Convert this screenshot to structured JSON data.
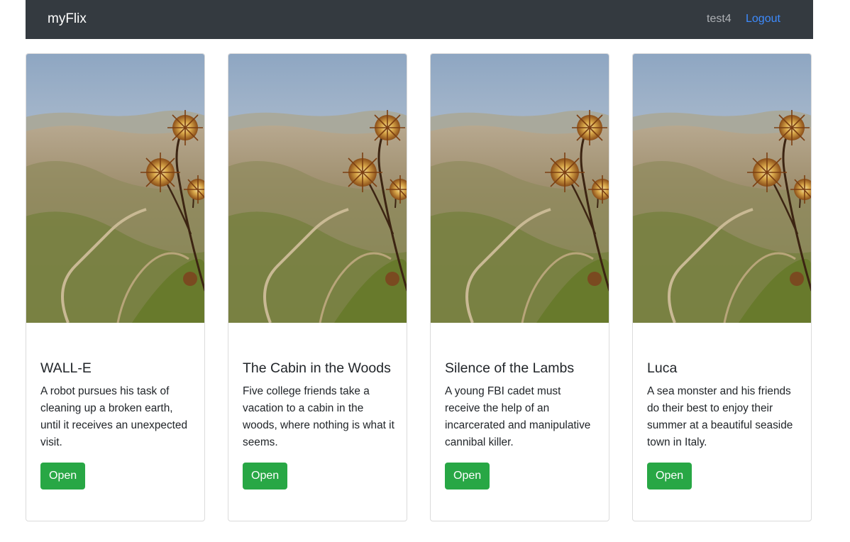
{
  "navbar": {
    "brand": "myFlix",
    "user": "test4",
    "logout": "Logout"
  },
  "movies": [
    {
      "title": "WALL-E",
      "description": "A robot pursues his task of cleaning up a broken earth, until it receives an unexpected visit.",
      "button": "Open"
    },
    {
      "title": "The Cabin in the Woods",
      "description": "Five college friends take a vacation to a cabin in the woods, where nothing is what it seems.",
      "button": "Open"
    },
    {
      "title": "Silence of the Lambs",
      "description": "A young FBI cadet must receive the help of an incarcerated and manipulative cannibal killer.",
      "button": "Open"
    },
    {
      "title": "Luca",
      "description": "A sea monster and his friends do their best to enjoy their summer at a beautiful seaside town in Italy.",
      "button": "Open"
    }
  ],
  "colors": {
    "navbar_bg": "#343a40",
    "link": "#3d8bfd",
    "button_bg": "#28a745"
  }
}
